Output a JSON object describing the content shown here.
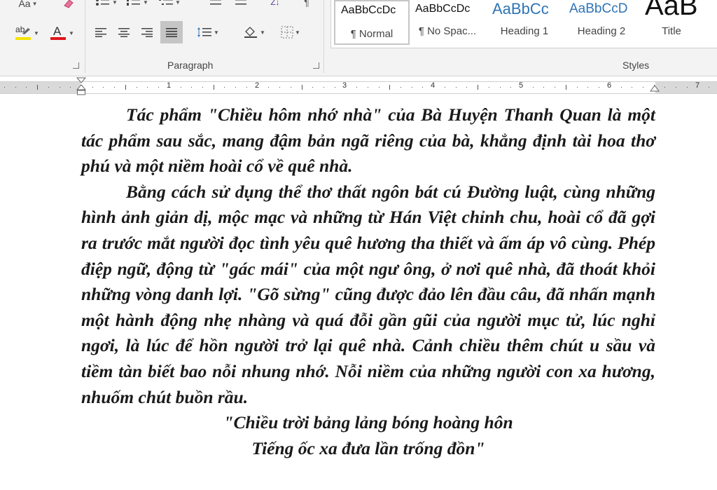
{
  "ribbon": {
    "font_group": {
      "change_case_label": "Aa",
      "highlight_label": "ab",
      "font_color_label": "A",
      "highlight_color": "#f5e400",
      "font_color": "#e0151b"
    },
    "paragraph_group": {
      "label": "Paragraph",
      "sort_label": "Z↓",
      "pilcrow": "¶"
    },
    "styles_group": {
      "label": "Styles",
      "items": [
        {
          "preview": "AaBbCcDc",
          "name": "¶ Normal"
        },
        {
          "preview": "AaBbCcDc",
          "name": "¶ No Spac..."
        },
        {
          "preview": "AaBbCc",
          "name": "Heading 1"
        },
        {
          "preview": "AaBbCcD",
          "name": "Heading 2"
        },
        {
          "preview": "AaB",
          "name": "Title"
        }
      ],
      "heading_color": "#2e74b5"
    }
  },
  "ruler": {
    "numbers": [
      "1",
      "2",
      "3",
      "4",
      "5",
      "6",
      "7"
    ]
  },
  "document": {
    "paragraphs": [
      "Tác phẩm \"Chiều hôm nhớ nhà\" của Bà Huyện Thanh Quan là một tác phẩm sau sắc, mang đậm bản ngã riêng của bà, khẳng định tài hoa thơ phú và một niềm hoài cổ về quê nhà.",
      "Bằng cách sử dụng thể thơ thất ngôn bát cú Đường luật, cùng những hình ảnh giản dị, mộc mạc và những từ Hán Việt chỉnh chu, hoài cổ đã gợi ra trước mắt người đọc tình yêu quê hương tha thiết và ấm áp vô cùng. Phép điệp ngữ, động từ \"gác mái\" của một ngư ông, ở nơi quê nhà, đã thoát khỏi những vòng danh lợi. \"Gõ sừng\" cũng được đảo lên đầu câu, đã nhấn mạnh một hành động nhẹ nhàng và quá đỗi gần gũi của người mục tử, lúc nghỉ ngơi, là lúc để hồn người trở lại quê nhà. Cảnh chiều thêm chút u sầu và tiềm tàn biết bao nỗi nhung nhớ. Nỗi niềm của những người con xa hương, nhuốm chút buồn rầu."
    ],
    "verse": [
      "\"Chiều trời bảng lảng bóng hoàng hôn",
      "Tiếng ốc xa đưa lần trống đồn\""
    ]
  }
}
